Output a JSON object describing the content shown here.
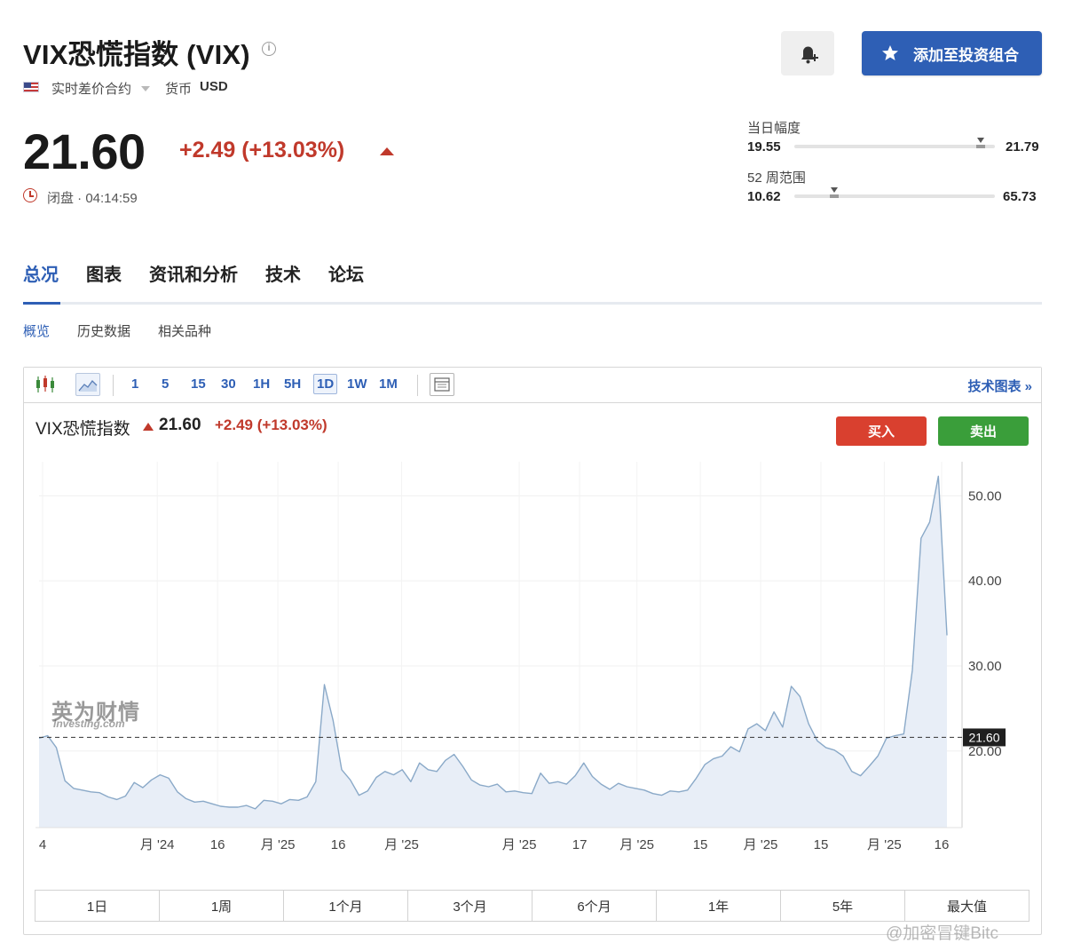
{
  "header": {
    "title": "VIX恐慌指数 (VIX)",
    "info_glyph": "i",
    "contract_type": "实时差价合约",
    "currency_label": "货币",
    "currency_value": "USD",
    "portfolio_button": "添加至投资组合"
  },
  "quote": {
    "price": "21.60",
    "change": "+2.49 (+13.03%)",
    "status": "闭盘 · 04:14:59"
  },
  "ranges": {
    "day": {
      "label": "当日幅度",
      "low": "19.55",
      "high": "21.79",
      "current_fraction": 0.93
    },
    "week52": {
      "label": "52 周范围",
      "low": "10.62",
      "high": "65.73",
      "current_fraction": 0.2
    }
  },
  "tabs": {
    "main": [
      "总况",
      "图表",
      "资讯和分析",
      "技术",
      "论坛"
    ],
    "sub": [
      "概览",
      "历史数据",
      "相关品种"
    ]
  },
  "toolbar": {
    "intervals": [
      "1",
      "5",
      "15",
      "30",
      "1H",
      "5H",
      "1D",
      "1W",
      "1M"
    ],
    "active_interval": "1D",
    "tech_chart_link": "技术图表 »"
  },
  "chart_header": {
    "name": "VIX恐慌指数",
    "price": "21.60",
    "change": "+2.49 (+13.03%)",
    "buy": "买入",
    "sell": "卖出"
  },
  "periods": [
    "1日",
    "1周",
    "1个月",
    "3个月",
    "6个月",
    "1年",
    "5年",
    "最大值"
  ],
  "watermark": {
    "main": "英为财情",
    "sub": "Investing.com",
    "corner": "@加密冒键Bitc"
  },
  "chart_data": {
    "type": "area",
    "xlim": [
      0,
      210
    ],
    "ylim": [
      11,
      54
    ],
    "yticks": [
      {
        "value": 20,
        "label": "20.00"
      },
      {
        "value": 30,
        "label": "30.00"
      },
      {
        "value": 40,
        "label": "40.00"
      },
      {
        "value": 50,
        "label": "50.00"
      }
    ],
    "xticks": [
      {
        "x": 2,
        "label": "4"
      },
      {
        "x": 40,
        "label": "月 '24"
      },
      {
        "x": 60,
        "label": "16"
      },
      {
        "x": 80,
        "label": "月 '25"
      },
      {
        "x": 100,
        "label": "16"
      },
      {
        "x": 121,
        "label": "月 '25"
      },
      {
        "x": 160,
        "label": "月 '25"
      },
      {
        "x": 180,
        "label": "17"
      },
      {
        "x": 199,
        "label": "月 '25"
      },
      {
        "x": 220,
        "label": "15"
      },
      {
        "x": 240,
        "label": "月 '25"
      },
      {
        "x": 260,
        "label": "15"
      },
      {
        "x": 281,
        "label": "月 '25"
      },
      {
        "x": 300,
        "label": "16"
      }
    ],
    "reference_line": {
      "value": 21.6,
      "label": "21.60"
    },
    "series": [
      {
        "points": [
          [
            0,
            21.5
          ],
          [
            2,
            21.8
          ],
          [
            4,
            20.4
          ],
          [
            6,
            16.5
          ],
          [
            8,
            15.6
          ],
          [
            10,
            15.4
          ],
          [
            12,
            15.2
          ],
          [
            14,
            15.1
          ],
          [
            16,
            14.6
          ],
          [
            18,
            14.3
          ],
          [
            20,
            14.7
          ],
          [
            22,
            16.3
          ],
          [
            24,
            15.7
          ],
          [
            26,
            16.6
          ],
          [
            28,
            17.2
          ],
          [
            30,
            16.8
          ],
          [
            32,
            15.2
          ],
          [
            34,
            14.4
          ],
          [
            36,
            14.0
          ],
          [
            38,
            14.1
          ],
          [
            40,
            13.8
          ],
          [
            42,
            13.5
          ],
          [
            44,
            13.4
          ],
          [
            46,
            13.4
          ],
          [
            48,
            13.6
          ],
          [
            50,
            13.2
          ],
          [
            52,
            14.2
          ],
          [
            54,
            14.1
          ],
          [
            56,
            13.8
          ],
          [
            58,
            14.3
          ],
          [
            60,
            14.2
          ],
          [
            62,
            14.6
          ],
          [
            64,
            16.4
          ],
          [
            66,
            27.8
          ],
          [
            68,
            23.6
          ],
          [
            70,
            17.8
          ],
          [
            72,
            16.6
          ],
          [
            74,
            14.8
          ],
          [
            76,
            15.3
          ],
          [
            78,
            16.9
          ],
          [
            80,
            17.6
          ],
          [
            82,
            17.2
          ],
          [
            84,
            17.8
          ],
          [
            86,
            16.4
          ],
          [
            88,
            18.6
          ],
          [
            90,
            17.8
          ],
          [
            92,
            17.6
          ],
          [
            94,
            18.9
          ],
          [
            96,
            19.6
          ],
          [
            98,
            18.2
          ],
          [
            100,
            16.6
          ],
          [
            102,
            16.0
          ],
          [
            104,
            15.8
          ],
          [
            106,
            16.1
          ],
          [
            108,
            15.2
          ],
          [
            110,
            15.3
          ],
          [
            112,
            15.1
          ],
          [
            114,
            15.0
          ],
          [
            116,
            17.4
          ],
          [
            118,
            16.2
          ],
          [
            120,
            16.4
          ],
          [
            122,
            16.1
          ],
          [
            124,
            17.1
          ],
          [
            126,
            18.6
          ],
          [
            128,
            17.0
          ],
          [
            130,
            16.1
          ],
          [
            132,
            15.5
          ],
          [
            134,
            16.2
          ],
          [
            136,
            15.8
          ],
          [
            138,
            15.6
          ],
          [
            140,
            15.4
          ],
          [
            142,
            15.0
          ],
          [
            144,
            14.8
          ],
          [
            146,
            15.3
          ],
          [
            148,
            15.2
          ],
          [
            150,
            15.4
          ],
          [
            152,
            16.8
          ],
          [
            154,
            18.4
          ],
          [
            156,
            19.1
          ],
          [
            158,
            19.4
          ],
          [
            160,
            20.5
          ],
          [
            162,
            19.9
          ],
          [
            164,
            22.6
          ],
          [
            166,
            23.2
          ],
          [
            168,
            22.4
          ],
          [
            170,
            24.6
          ],
          [
            172,
            22.8
          ],
          [
            174,
            27.6
          ],
          [
            176,
            26.4
          ],
          [
            178,
            23.2
          ],
          [
            180,
            21.2
          ],
          [
            182,
            20.4
          ],
          [
            184,
            20.1
          ],
          [
            186,
            19.4
          ],
          [
            188,
            17.6
          ],
          [
            190,
            17.1
          ],
          [
            192,
            18.2
          ],
          [
            194,
            19.4
          ],
          [
            196,
            21.5
          ],
          [
            198,
            21.8
          ],
          [
            200,
            22.0
          ],
          [
            202,
            29.5
          ],
          [
            204,
            45.0
          ],
          [
            206,
            46.9
          ],
          [
            208,
            52.3
          ],
          [
            210,
            33.6
          ]
        ],
        "color": "#8aa9c8",
        "fill": "#e8eef7"
      }
    ]
  }
}
